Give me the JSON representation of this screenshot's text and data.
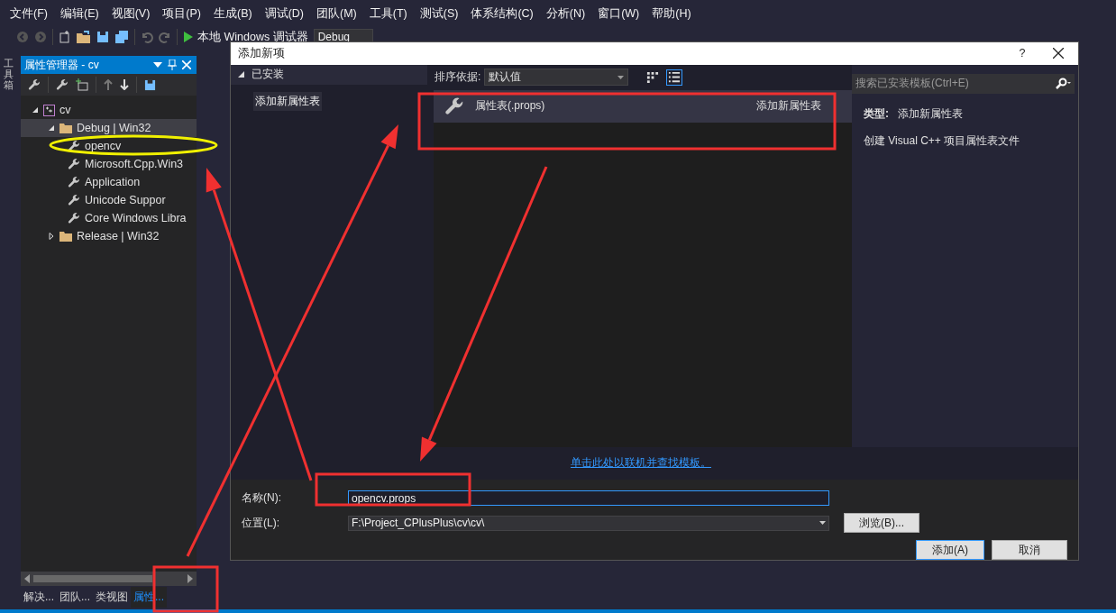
{
  "menu_bar": [
    "文件(F)",
    "编辑(E)",
    "视图(V)",
    "项目(P)",
    "生成(B)",
    "调试(D)",
    "团队(M)",
    "工具(T)",
    "测试(S)",
    "体系结构(C)",
    "分析(N)",
    "窗口(W)",
    "帮助(H)"
  ],
  "toolbar": {
    "debugger": "本地 Windows 调试器",
    "configuration": "Debug"
  },
  "toolbox_tab": "工具箱",
  "property_manager": {
    "title": "属性管理器 - cv",
    "tree": [
      {
        "label": "cv",
        "kind": "project",
        "expanded": true,
        "selected": false,
        "children": [
          {
            "label": "Debug | Win32",
            "kind": "folder",
            "expanded": true,
            "selected": true,
            "children": [
              {
                "label": "opencv",
                "kind": "sheet",
                "selected": false
              },
              {
                "label": "Microsoft.Cpp.Win3",
                "kind": "sheet",
                "selected": false
              },
              {
                "label": "Application",
                "kind": "sheet",
                "selected": false
              },
              {
                "label": "Unicode Suppor",
                "kind": "sheet",
                "selected": false
              },
              {
                "label": "Core Windows Libra",
                "kind": "sheet",
                "selected": false
              }
            ]
          },
          {
            "label": "Release | Win32",
            "kind": "folder",
            "expanded": false,
            "selected": false
          }
        ]
      }
    ],
    "bottom_tabs": [
      {
        "label": "解决...",
        "selected": false
      },
      {
        "label": "团队...",
        "selected": false
      },
      {
        "label": "类视图",
        "selected": false
      },
      {
        "label": "属性...",
        "selected": true
      }
    ]
  },
  "dialog": {
    "title": "添加新项",
    "help": "?",
    "categories": {
      "header": "已安装",
      "expanded": true,
      "items": [
        {
          "label": "添加新属性表",
          "selected": true
        }
      ]
    },
    "sort": {
      "label": "排序依据:",
      "value": "默认值"
    },
    "view_modes": [
      {
        "kind": "grid",
        "selected": false
      },
      {
        "kind": "list",
        "selected": true
      }
    ],
    "search": {
      "placeholder": "搜索已安装模板(Ctrl+E)"
    },
    "templates": [
      {
        "name": "属性表(.props)",
        "category": "添加新属性表",
        "selected": true
      }
    ],
    "details": {
      "type_label": "类型:",
      "type_value": "添加新属性表",
      "description": "创建 Visual C++ 项目属性表文件"
    },
    "online_link": "单击此处以联机并查找模板。",
    "name_field": {
      "label": "名称(N):",
      "value": "opencv.props"
    },
    "location_field": {
      "label": "位置(L):",
      "value": "F:\\Project_CPlusPlus\\cv\\cv\\"
    },
    "browse_button": "浏览(B)...",
    "buttons": [
      {
        "label": "添加(A)",
        "kind": "primary"
      },
      {
        "label": "取消",
        "kind": "secondary"
      }
    ]
  }
}
